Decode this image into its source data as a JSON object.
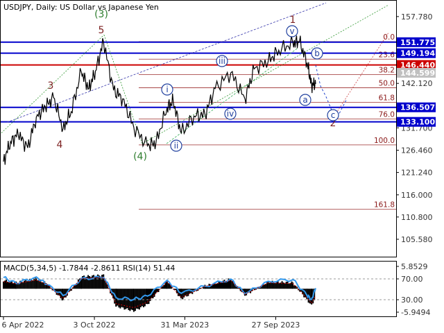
{
  "chart_data": [
    {
      "type": "line",
      "title": "USDJPY, Daily:  US Dollar vs Japanese Yen",
      "date_range": [
        "2022-04-06",
        "2023-12-15"
      ],
      "x_ticks": [
        "6 Apr 2022",
        "3 Oct 2022",
        "31 Mar 2023",
        "27 Sep 2023"
      ],
      "y_ticks": [
        157.78,
        152.01,
        146.44,
        142.12,
        136.82,
        131.7,
        126.46,
        121.24,
        116.0,
        110.8,
        105.58
      ],
      "ylim": [
        101.5,
        161.5
      ],
      "price_labels": [
        {
          "text": "151.775",
          "value": 151.775,
          "color": "#0000cc"
        },
        {
          "text": "149.194",
          "value": 149.194,
          "color": "#0000cc"
        },
        {
          "text": "146.440",
          "value": 146.44,
          "color": "#cc0000"
        },
        {
          "text": "144.599",
          "value": 144.599,
          "color": "#c0c0c0"
        },
        {
          "text": "136.507",
          "value": 136.507,
          "color": "#0000cc"
        },
        {
          "text": "133.100",
          "value": 133.1,
          "color": "#0000cc"
        }
      ],
      "fib_levels": [
        {
          "label": "0.0",
          "value": 151.9
        },
        {
          "label": "23.6",
          "value": 147.8
        },
        {
          "label": "38.2",
          "value": 144.2
        },
        {
          "label": "50.0",
          "value": 141.1
        },
        {
          "label": "61.8",
          "value": 137.7
        },
        {
          "label": "76.0",
          "value": 133.8
        },
        {
          "label": "100.0",
          "value": 127.7
        },
        {
          "label": "161.8",
          "value": 112.6
        }
      ],
      "wave_labels": [
        {
          "text": "(3)",
          "style": "green"
        },
        {
          "text": "5",
          "style": "dark"
        },
        {
          "text": "3",
          "style": "dark"
        },
        {
          "text": "4",
          "style": "dark"
        },
        {
          "text": "(4)",
          "style": "green"
        },
        {
          "text": "1",
          "style": "dark"
        },
        {
          "text": "2",
          "style": "dark"
        },
        {
          "text": "i",
          "style": "circle"
        },
        {
          "text": "ii",
          "style": "circle"
        },
        {
          "text": "iii",
          "style": "circle"
        },
        {
          "text": "iv",
          "style": "circle"
        },
        {
          "text": "v",
          "style": "circle"
        },
        {
          "text": "a",
          "style": "circle"
        },
        {
          "text": "b",
          "style": "circle"
        },
        {
          "text": "c",
          "style": "circle"
        }
      ],
      "price_series": [
        [
          "2022-04-06",
          123.8
        ],
        [
          "2022-04-20",
          128.5
        ],
        [
          "2022-05-05",
          130.2
        ],
        [
          "2022-05-24",
          127.0
        ],
        [
          "2022-06-10",
          134.2
        ],
        [
          "2022-06-28",
          136.6
        ],
        [
          "2022-07-14",
          138.8
        ],
        [
          "2022-08-02",
          131.5
        ],
        [
          "2022-08-18",
          135.5
        ],
        [
          "2022-09-07",
          144.8
        ],
        [
          "2022-09-22",
          140.9
        ],
        [
          "2022-10-05",
          145.0
        ],
        [
          "2022-10-21",
          151.9
        ],
        [
          "2022-11-10",
          140.5
        ],
        [
          "2022-11-28",
          138.5
        ],
        [
          "2022-12-20",
          131.8
        ],
        [
          "2023-01-16",
          127.5
        ],
        [
          "2023-02-02",
          128.3
        ],
        [
          "2023-02-24",
          136.5
        ],
        [
          "2023-03-08",
          137.9
        ],
        [
          "2023-03-24",
          130.5
        ],
        [
          "2023-04-18",
          134.5
        ],
        [
          "2023-05-10",
          134.8
        ],
        [
          "2023-05-30",
          140.9
        ],
        [
          "2023-06-30",
          144.6
        ],
        [
          "2023-07-28",
          138.5
        ],
        [
          "2023-08-15",
          145.5
        ],
        [
          "2023-09-12",
          147.3
        ],
        [
          "2023-10-03",
          149.9
        ],
        [
          "2023-10-31",
          151.6
        ],
        [
          "2023-11-13",
          151.9
        ],
        [
          "2023-11-28",
          147.0
        ],
        [
          "2023-12-07",
          141.7
        ],
        [
          "2023-12-15",
          142.0
        ]
      ]
    },
    {
      "type": "line",
      "title": "MACD(5,34,5) -1.7844 -2.8611 RSI(14) 51.44",
      "macd_value": -1.7844,
      "signal_value": -2.8611,
      "rsi_value": 51.44,
      "y_ticks": [
        "5.8529",
        "70.00",
        "30.00",
        "-5.9494"
      ],
      "macd_range": [
        -5.9494,
        5.8529
      ],
      "rsi_levels": [
        30,
        70
      ],
      "macd_series": [
        [
          "2022-04-06",
          1.8
        ],
        [
          "2022-05-01",
          1.3
        ],
        [
          "2022-06-10",
          2.2
        ],
        [
          "2022-07-01",
          1.1
        ],
        [
          "2022-08-02",
          -2.5
        ],
        [
          "2022-09-07",
          2.6
        ],
        [
          "2022-10-21",
          2.9
        ],
        [
          "2022-11-15",
          -3.8
        ],
        [
          "2022-12-20",
          -4.8
        ],
        [
          "2023-01-16",
          -3.4
        ],
        [
          "2023-02-24",
          1.8
        ],
        [
          "2023-03-24",
          -2.2
        ],
        [
          "2023-05-10",
          0.6
        ],
        [
          "2023-06-30",
          2.1
        ],
        [
          "2023-07-28",
          -1.4
        ],
        [
          "2023-09-12",
          1.5
        ],
        [
          "2023-10-31",
          1.3
        ],
        [
          "2023-11-28",
          -2.4
        ],
        [
          "2023-12-07",
          -3.6
        ],
        [
          "2023-12-15",
          -1.78
        ]
      ],
      "rsi_series": [
        [
          "2022-04-06",
          71
        ],
        [
          "2022-05-01",
          60
        ],
        [
          "2022-06-10",
          72
        ],
        [
          "2022-07-01",
          58
        ],
        [
          "2022-08-02",
          38
        ],
        [
          "2022-09-07",
          69
        ],
        [
          "2022-10-21",
          71
        ],
        [
          "2022-11-15",
          34
        ],
        [
          "2022-12-20",
          31
        ],
        [
          "2023-01-16",
          37
        ],
        [
          "2023-02-24",
          66
        ],
        [
          "2023-03-24",
          42
        ],
        [
          "2023-05-10",
          55
        ],
        [
          "2023-06-30",
          68
        ],
        [
          "2023-07-28",
          41
        ],
        [
          "2023-09-12",
          64
        ],
        [
          "2023-10-31",
          67
        ],
        [
          "2023-11-28",
          38
        ],
        [
          "2023-12-07",
          31
        ],
        [
          "2023-12-15",
          51.44
        ]
      ]
    }
  ],
  "colors": {
    "price": "#000000",
    "blue_level": "#0000cc",
    "red_level": "#cc0000",
    "fib_line": "#9b2c2c",
    "projection": "#2244cc",
    "trend_green": "#339933",
    "trend_blue": "#3333aa",
    "wave_dark": "#7d2222",
    "wave_green": "#2e7d2e",
    "circle_label": "#1f3f9e",
    "rsi": "#3399ee",
    "macd_hist": "#000000",
    "macd_signal": "#cc0000"
  }
}
